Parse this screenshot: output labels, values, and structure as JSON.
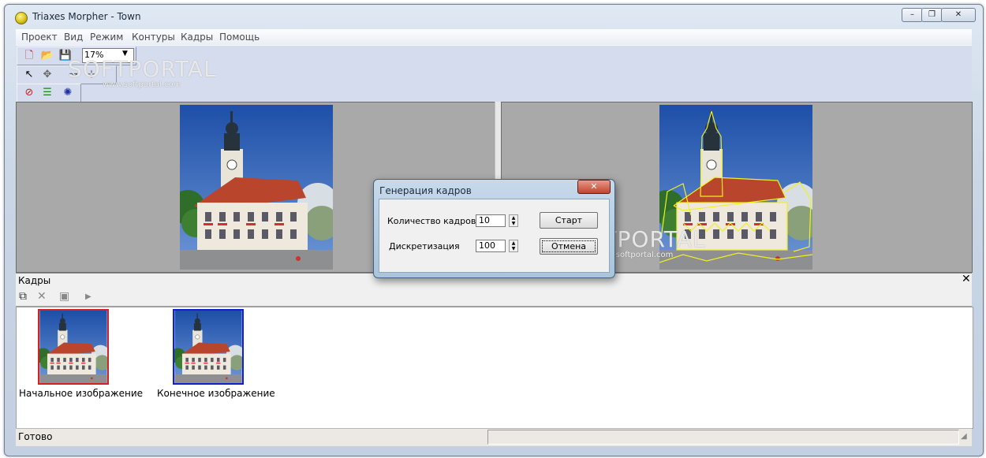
{
  "window": {
    "title": "Triaxes Morpher - Town"
  },
  "menu": [
    "Проект",
    "Вид",
    "Режим",
    "Контуры",
    "Кадры",
    "Помощь"
  ],
  "toolbar": {
    "zoom_value": "17%"
  },
  "watermark": {
    "text_main": "SOFTPORTAL",
    "text_sub": "www.softportal.com"
  },
  "frames_panel": {
    "title": "Кадры",
    "items": [
      {
        "caption": "Начальное изображение",
        "border_color": "#d42020"
      },
      {
        "caption": "Конечное изображение",
        "border_color": "#1020d0"
      }
    ]
  },
  "status": {
    "text": "Готово"
  },
  "dialog": {
    "title": "Генерация кадров",
    "frame_count_label": "Количество кадров",
    "frame_count_value": "10",
    "sampling_label": "Дискретизация",
    "sampling_value": "100",
    "start_label": "Старт",
    "cancel_label": "Отмена"
  },
  "colors": {
    "contour": "#f0f020",
    "sky": "#2f5fb8",
    "roof": "#b8452c"
  }
}
